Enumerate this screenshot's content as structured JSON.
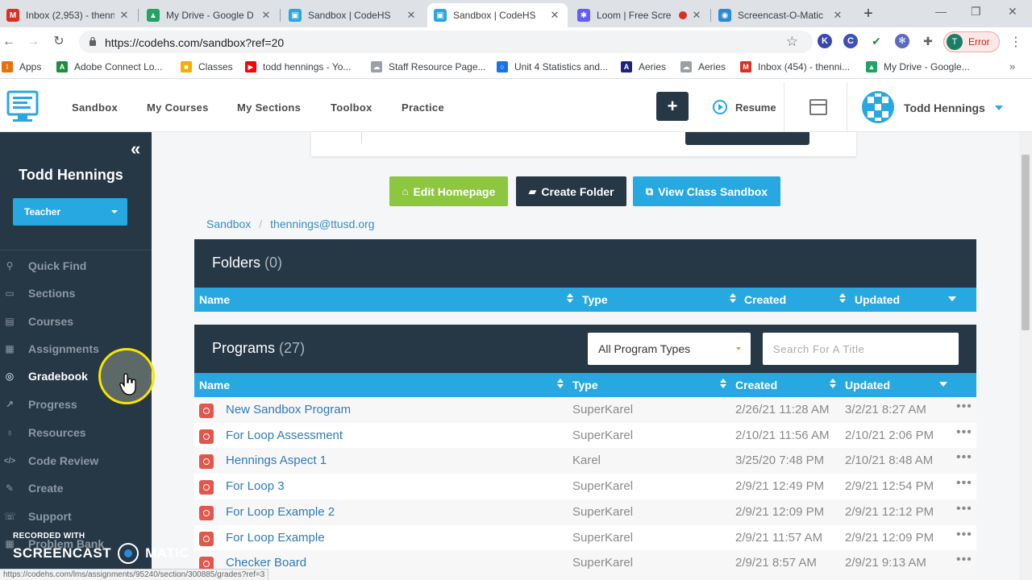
{
  "browser": {
    "tabs": [
      {
        "title": "Inbox (2,953) - thenn",
        "icon": "gmail-icon",
        "color": "#d93025",
        "glyph": "M"
      },
      {
        "title": "My Drive - Google D",
        "icon": "drive-icon",
        "color": "#1fa463",
        "glyph": "▲"
      },
      {
        "title": "Sandbox | CodeHS",
        "icon": "codehs-icon",
        "color": "#28a8e0",
        "glyph": "▣"
      },
      {
        "title": "Sandbox | CodeHS",
        "icon": "codehs-icon",
        "color": "#28a8e0",
        "glyph": "▣"
      },
      {
        "title": "Loom | Free Scre",
        "icon": "loom-icon",
        "color": "#625df5",
        "glyph": "✱"
      },
      {
        "title": "Screencast-O-Matic",
        "icon": "screencast-icon",
        "color": "#2b8ad6",
        "glyph": "◉"
      }
    ],
    "url": "https://codehs.com/sandbox?ref=20",
    "profile_label": "Error",
    "profile_initial": "T",
    "extensions": [
      {
        "name": "k-extension-icon",
        "glyph": "K",
        "color": "#3949ab"
      },
      {
        "name": "c-extension-icon",
        "glyph": "C",
        "color": "#3f51b5"
      },
      {
        "name": "check-extension-icon",
        "glyph": "✔",
        "color": "#1e8e3e"
      },
      {
        "name": "gear-extension-icon",
        "glyph": "✻",
        "color": "#5c6bc0"
      },
      {
        "name": "puzzle-icon",
        "glyph": "✚",
        "color": "#5f6368"
      }
    ],
    "bookmarks": [
      {
        "label": "Apps",
        "icon": "apps-grid-icon",
        "color": "#e8710a",
        "glyph": "⁞"
      },
      {
        "label": "Adobe Connect Lo...",
        "icon": "adobe-icon",
        "color": "#1e8e3e",
        "glyph": "A"
      },
      {
        "label": "Classes",
        "icon": "classroom-icon",
        "color": "#f9ab00",
        "glyph": "■"
      },
      {
        "label": "todd hennings - Yo...",
        "icon": "youtube-icon",
        "color": "#ff0000",
        "glyph": "▶"
      },
      {
        "label": "Staff Resource Page...",
        "icon": "cloud-icon",
        "color": "#9aa0a6",
        "glyph": "☁"
      },
      {
        "label": "Unit 4 Statistics and...",
        "icon": "circle-bookmark-icon",
        "color": "#1a73e8",
        "glyph": "○"
      },
      {
        "label": "Aeries",
        "icon": "aeries-icon",
        "color": "#1a237e",
        "glyph": "A"
      },
      {
        "label": "Aeries",
        "icon": "cloud-icon",
        "color": "#9aa0a6",
        "glyph": "☁"
      },
      {
        "label": "Inbox (454) - thenni...",
        "icon": "gmail-icon",
        "color": "#d93025",
        "glyph": "M"
      },
      {
        "label": "My Drive - Google...",
        "icon": "drive-icon",
        "color": "#1fa463",
        "glyph": "▲"
      }
    ]
  },
  "header": {
    "nav": [
      "Sandbox",
      "My Courses",
      "My Sections",
      "Toolbox",
      "Practice"
    ],
    "plus_label": "+",
    "resume_label": "Resume",
    "user_name": "Todd Hennings"
  },
  "sidebar": {
    "user_name": "Todd Hennings",
    "role_label": "Teacher",
    "items": [
      {
        "label": "Quick Find",
        "icon": "search-icon",
        "glyph": "⚲"
      },
      {
        "label": "Sections",
        "icon": "monitor-icon",
        "glyph": "▭"
      },
      {
        "label": "Courses",
        "icon": "book-icon",
        "glyph": "▤"
      },
      {
        "label": "Assignments",
        "icon": "calendar-icon",
        "glyph": "▦"
      },
      {
        "label": "Gradebook",
        "icon": "gradebook-icon",
        "glyph": "◎"
      },
      {
        "label": "Progress",
        "icon": "chart-icon",
        "glyph": "↗"
      },
      {
        "label": "Resources",
        "icon": "lightbulb-icon",
        "glyph": "♁"
      },
      {
        "label": "Code Review",
        "icon": "code-icon",
        "glyph": "</>"
      },
      {
        "label": "Create",
        "icon": "pencil-icon",
        "glyph": "✎"
      },
      {
        "label": "Support",
        "icon": "support-icon",
        "glyph": "☏"
      },
      {
        "label": "Problem Bank",
        "icon": "grid-icon",
        "glyph": "▦"
      }
    ],
    "active_index": 4
  },
  "main": {
    "actions": [
      {
        "label": "Edit Homepage",
        "icon": "home-icon",
        "glyph": "⌂",
        "color": "#8dc63f"
      },
      {
        "label": "Create Folder",
        "icon": "folder-icon",
        "glyph": "▰",
        "color": "#263746"
      },
      {
        "label": "View Class Sandbox",
        "icon": "external-link-icon",
        "glyph": "⧉",
        "color": "#28a8e0"
      }
    ],
    "breadcrumb": [
      "Sandbox",
      "thennings@ttusd.org"
    ],
    "folders": {
      "title": "Folders",
      "count": "(0)",
      "columns": [
        "Name",
        "Type",
        "Created",
        "Updated"
      ]
    },
    "programs": {
      "title": "Programs",
      "count": "(27)",
      "type_filter": "All Program Types",
      "search_placeholder": "Search For A Title",
      "columns": [
        "Name",
        "Type",
        "Created",
        "Updated"
      ],
      "rows": [
        {
          "name": "New Sandbox Program",
          "type": "SuperKarel",
          "created": "2/26/21 11:28 AM",
          "updated": "3/2/21 8:27 AM"
        },
        {
          "name": "For Loop Assessment",
          "type": "SuperKarel",
          "created": "2/10/21 11:56 AM",
          "updated": "2/10/21 2:06 PM"
        },
        {
          "name": "Hennings Aspect 1",
          "type": "Karel",
          "created": "3/25/20 7:48 PM",
          "updated": "2/10/21 8:48 AM"
        },
        {
          "name": "For Loop 3",
          "type": "SuperKarel",
          "created": "2/9/21 12:49 PM",
          "updated": "2/9/21 12:54 PM"
        },
        {
          "name": "For Loop Example 2",
          "type": "SuperKarel",
          "created": "2/9/21 12:09 PM",
          "updated": "2/9/21 12:12 PM"
        },
        {
          "name": "For Loop Example",
          "type": "SuperKarel",
          "created": "2/9/21 11:57 AM",
          "updated": "2/9/21 12:09 PM"
        },
        {
          "name": "Checker Board",
          "type": "SuperKarel",
          "created": "2/9/21 8:57 AM",
          "updated": "2/9/21 9:13 AM"
        }
      ]
    }
  },
  "overlay": {
    "status_url": "https://codehs.com/lms/assignments/95240/section/300885/grades?ref=3",
    "watermark_line1": "RECORDED WITH",
    "watermark_part1": "SCREENCAST",
    "watermark_part2": "MATIC"
  }
}
